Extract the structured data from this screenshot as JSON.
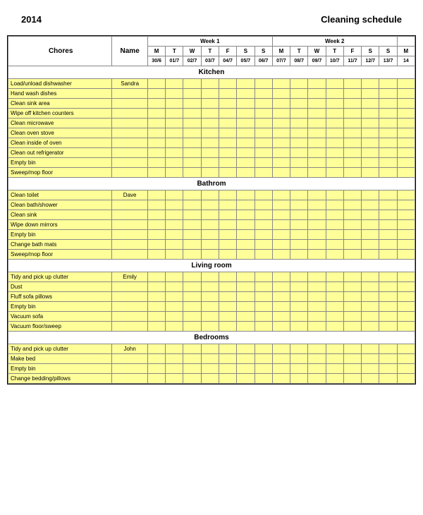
{
  "header": {
    "year": "2014",
    "title": "Cleaning schedule"
  },
  "weeks": {
    "week1_label": "Week 1",
    "week2_label": "Week 2"
  },
  "days": [
    "M",
    "T",
    "W",
    "T",
    "F",
    "S",
    "S",
    "M",
    "T",
    "W",
    "T",
    "F",
    "S",
    "S",
    "M"
  ],
  "dates": [
    "30/6",
    "01/7",
    "02/7",
    "03/7",
    "04/7",
    "05/7",
    "06/7",
    "07/7",
    "08/7",
    "09/7",
    "10/7",
    "11/7",
    "12/7",
    "13/7",
    "14"
  ],
  "columns": {
    "chores": "Chores",
    "name": "Name"
  },
  "sections": [
    {
      "title": "Kitchen",
      "chores": [
        {
          "chore": "Load/unload dishwasher",
          "name": "Sandra"
        },
        {
          "chore": "Hand wash dishes",
          "name": ""
        },
        {
          "chore": "Clean sink area",
          "name": ""
        },
        {
          "chore": "Wipe off kitchen counters",
          "name": ""
        },
        {
          "chore": "Clean microwave",
          "name": ""
        },
        {
          "chore": "Clean oven stove",
          "name": ""
        },
        {
          "chore": "Clean inside of oven",
          "name": ""
        },
        {
          "chore": "Clean out refrigerator",
          "name": ""
        },
        {
          "chore": "Empty bin",
          "name": ""
        },
        {
          "chore": "Sweep/mop floor",
          "name": ""
        }
      ]
    },
    {
      "title": "Bathrom",
      "chores": [
        {
          "chore": "Clean toilet",
          "name": "Dave"
        },
        {
          "chore": "Clean bath/shower",
          "name": ""
        },
        {
          "chore": "Clean sink",
          "name": ""
        },
        {
          "chore": "Wipe down mirrors",
          "name": ""
        },
        {
          "chore": "Empty bin",
          "name": ""
        },
        {
          "chore": "Change bath mats",
          "name": ""
        },
        {
          "chore": "Sweep/mop floor",
          "name": ""
        }
      ]
    },
    {
      "title": "Living room",
      "chores": [
        {
          "chore": "Tidy and pick up clutter",
          "name": "Emily"
        },
        {
          "chore": "Dust",
          "name": ""
        },
        {
          "chore": "Fluff sofa pillows",
          "name": ""
        },
        {
          "chore": "Empty bin",
          "name": ""
        },
        {
          "chore": "Vacuum sofa",
          "name": ""
        },
        {
          "chore": "Vacuum floor/sweep",
          "name": ""
        }
      ]
    },
    {
      "title": "Bedrooms",
      "chores": [
        {
          "chore": "Tidy and pick up clutter",
          "name": "John"
        },
        {
          "chore": "Make bed",
          "name": ""
        },
        {
          "chore": "Empty bin",
          "name": ""
        },
        {
          "chore": "Change bedding/pillows",
          "name": ""
        }
      ]
    }
  ]
}
